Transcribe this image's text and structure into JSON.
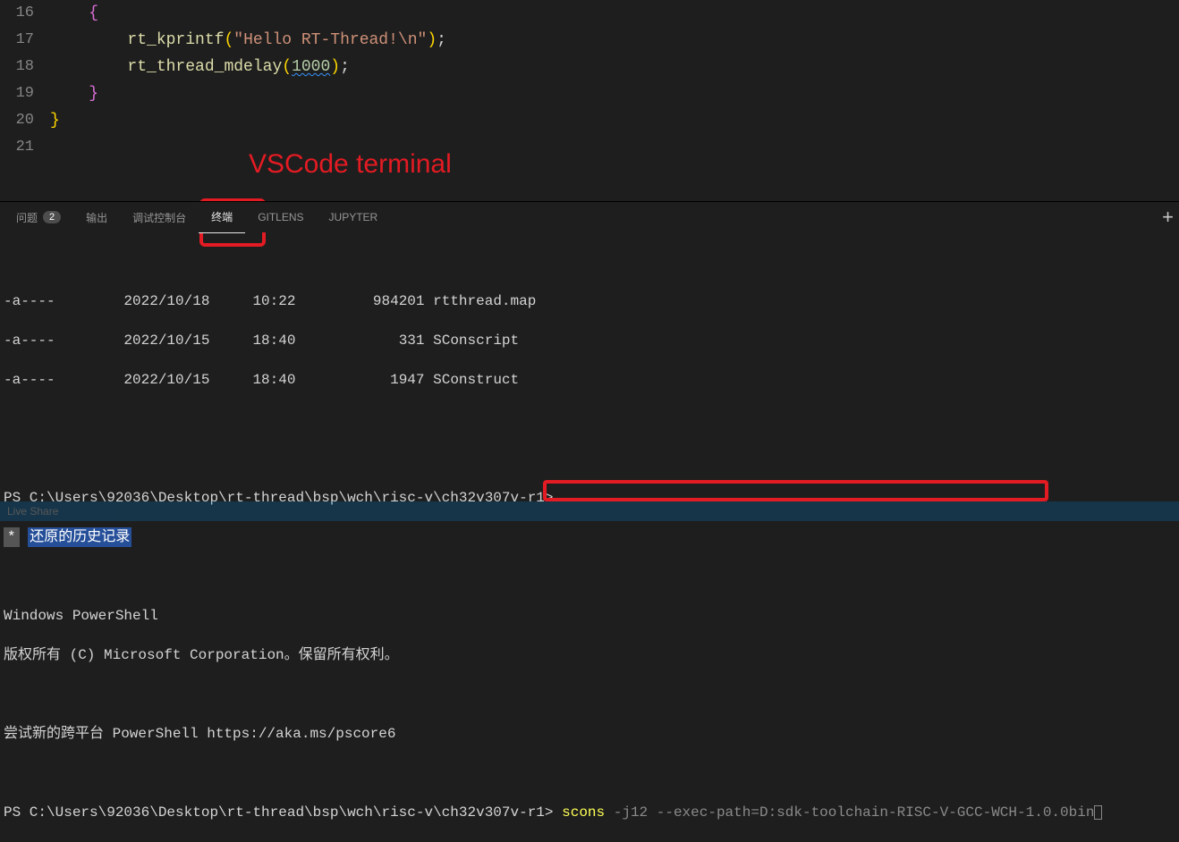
{
  "editor": {
    "gutter": [
      "16",
      "17",
      "18",
      "19",
      "20",
      "21"
    ],
    "lines": {
      "l16": {
        "indent": "    ",
        "brace": "{"
      },
      "l17": {
        "indent": "        ",
        "fn": "rt_kprintf",
        "lp": "(",
        "str": "\"Hello RT-Thread!\\n\"",
        "rp": ")",
        "semi": ";"
      },
      "l18": {
        "indent": "        ",
        "fn": "rt_thread_mdelay",
        "lp": "(",
        "num": "1000",
        "rp": ")",
        "semi": ";"
      },
      "l19": {
        "indent": "    ",
        "brace": "}"
      },
      "l20": {
        "indent": "",
        "brace": "}"
      }
    }
  },
  "annotation": "VSCode terminal",
  "panel": {
    "tabs": {
      "problems": "问题",
      "problems_count": "2",
      "output": "输出",
      "debug": "调试控制台",
      "terminal": "终端",
      "gitlens": "GITLENS",
      "jupyter": "JUPYTER"
    }
  },
  "terminal": {
    "rows": [
      {
        "mode": "-a----",
        "date": "2022/10/18",
        "time": "10:22",
        "size": "984201",
        "name": "rtthread.map"
      },
      {
        "mode": "-a----",
        "date": "2022/10/15",
        "time": "18:40",
        "size": "331",
        "name": "SConscript"
      },
      {
        "mode": "-a----",
        "date": "2022/10/15",
        "time": "18:40",
        "size": "1947",
        "name": "SConstruct"
      }
    ],
    "prompt_path": "PS C:\\Users\\92036\\Desktop\\rt-thread\\bsp\\wch\\risc-v\\ch32v307v-r1>",
    "history_star": "*",
    "history_text": "还原的历史记录",
    "ps_header": "Windows PowerShell",
    "ps_copyright": "版权所有 (C) Microsoft Corporation。保留所有权利。",
    "ps_try": "尝试新的跨平台 PowerShell https://aka.ms/pscore6",
    "cmd_exec": "scons",
    "cmd_args": "-j12 --exec-path=D:sdk-toolchain-RISC-V-GCC-WCH-1.0.0bin"
  },
  "statusbar": {
    "left": "Live Share"
  }
}
